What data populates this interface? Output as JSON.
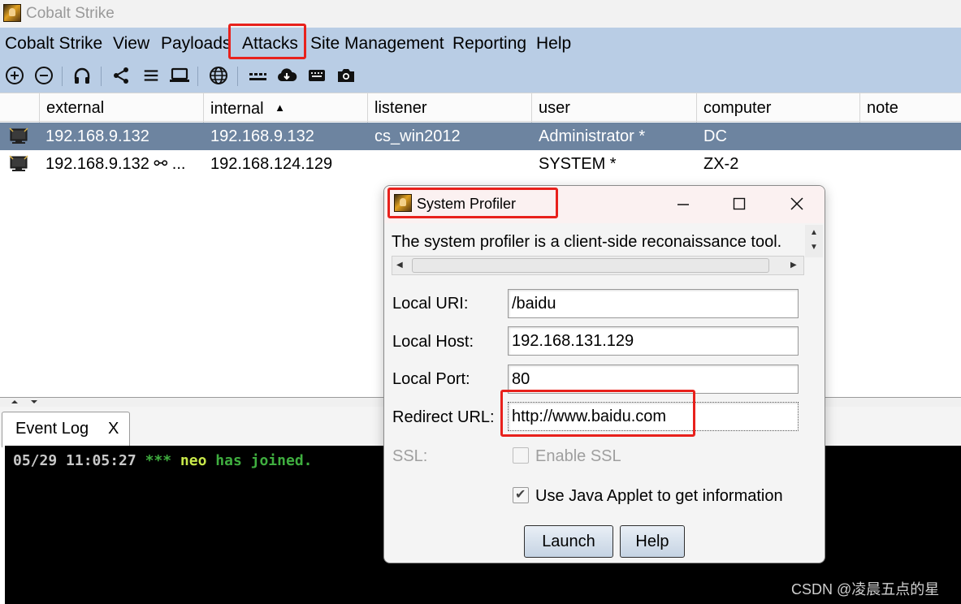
{
  "window": {
    "title": "Cobalt Strike"
  },
  "menu": {
    "items": [
      {
        "label": "Cobalt Strike"
      },
      {
        "label": "View"
      },
      {
        "label": "Payloads"
      },
      {
        "label": "Attacks"
      },
      {
        "label": "Site Management"
      },
      {
        "label": "Reporting"
      },
      {
        "label": "Help"
      }
    ]
  },
  "toolbar": {
    "icons": [
      "add-connection-icon",
      "remove-connection-icon",
      "headphones-icon",
      "share-pivot-icon",
      "list-icon",
      "laptop-icon",
      "globe-icon",
      "keyboard-icon",
      "cloud-download-icon",
      "keystrokes-icon",
      "camera-icon"
    ]
  },
  "table": {
    "columns": [
      "external",
      "internal",
      "listener",
      "user",
      "computer",
      "note"
    ],
    "sort_indicator": "▲",
    "rows": [
      {
        "external": "192.168.9.132",
        "internal": "192.168.9.132",
        "listener": "cs_win2012",
        "user": "Administrator *",
        "computer": "DC",
        "note": "",
        "selected": true
      },
      {
        "external": "192.168.9.132 ⚯ ...",
        "internal": "192.168.124.129",
        "listener": "",
        "user": "SYSTEM *",
        "computer": "ZX-2",
        "note": "",
        "selected": false
      }
    ]
  },
  "event_log": {
    "tab_label": "Event Log",
    "tab_close": "X",
    "line": {
      "time": "05/29 11:05:27",
      "stars": "***",
      "user": "neo",
      "message": "has joined."
    }
  },
  "dialog": {
    "title": "System Profiler",
    "controls": {
      "minimize": "—",
      "maximize": "☐",
      "close": "✕"
    },
    "description": "The system profiler is a client-side reconaissance tool.",
    "fields": {
      "local_uri": {
        "label": "Local URI:",
        "value": "/baidu"
      },
      "local_host": {
        "label": "Local Host:",
        "value": "192.168.131.129"
      },
      "local_port": {
        "label": "Local Port:",
        "value": "80"
      },
      "redirect_url": {
        "label": "Redirect URL:",
        "value": "http://www.baidu.com"
      }
    },
    "ssl": {
      "label": "SSL:",
      "checkbox_label": "Enable SSL",
      "checked": false,
      "enabled": false
    },
    "java_applet": {
      "checkbox_label": "Use Java Applet to get information",
      "checked": true
    },
    "buttons": {
      "launch": "Launch",
      "help": "Help"
    }
  },
  "watermark": "CSDN @凌晨五点的星",
  "colors": {
    "menubar_bg": "#b9cde5",
    "selected_row": "#6d84a0",
    "highlight_box": "#e8211c",
    "console_bg": "#000000"
  }
}
